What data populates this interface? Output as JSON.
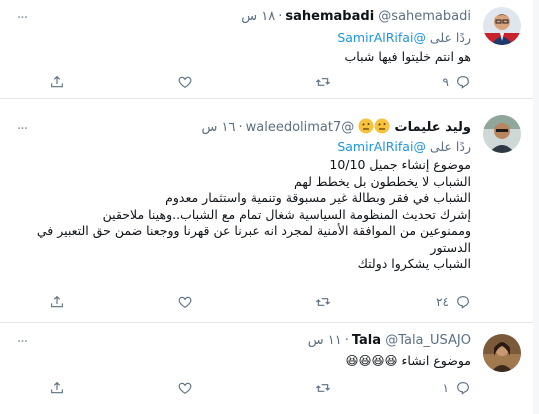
{
  "tweets": [
    {
      "name": "sahemabadi",
      "handle": "@sahemabadi",
      "time": "١٨ س",
      "reply_label": "ردًا على",
      "reply_to": "@SamirAlRifai",
      "text": "هو انتم خليتوا فيها شباب",
      "reply_count": "٩",
      "retweet_count": "",
      "like_count": ""
    },
    {
      "name": "وليد عليمات",
      "handle": "@waleedolimat7",
      "time": "١٦ س",
      "reply_label": "ردًا على",
      "reply_to": "@SamirAlRifai",
      "text": "موضوع إنشاء جميل 10/10\nالشباب لا يخططون بل يخطط لهم\nالشباب في فقر وبطالة غير مسبوقة وتنمية واستثمار معدوم\nإشرك تحديث المنظومة السياسية شغال تمام مع الشباب..وهينا ملاحقين\nوممنوعين من الموافقة الأمنية لمجرد انه عبرنا عن قهرنا ووجعنا ضمن حق التعبير في الدستور\nالشباب يشكروا دولتك",
      "reply_count": "٢٤",
      "retweet_count": "",
      "like_count": ""
    },
    {
      "name": "Tala",
      "handle": "@Tala_USAJO",
      "time": "١١ س",
      "reply_label": "",
      "reply_to": "",
      "text": "موضوع انشاء 😆😆😆😆",
      "reply_count": "١",
      "retweet_count": "",
      "like_count": ""
    }
  ],
  "icons": {
    "more": "more-icon",
    "reply": "reply-icon",
    "retweet": "retweet-icon",
    "like": "like-icon",
    "share": "share-icon",
    "thinking_emoji": "thinking-face-emoji"
  },
  "colors": {
    "link": "#1b95e0",
    "muted": "#5b7083",
    "divider": "#e1e8ed"
  }
}
